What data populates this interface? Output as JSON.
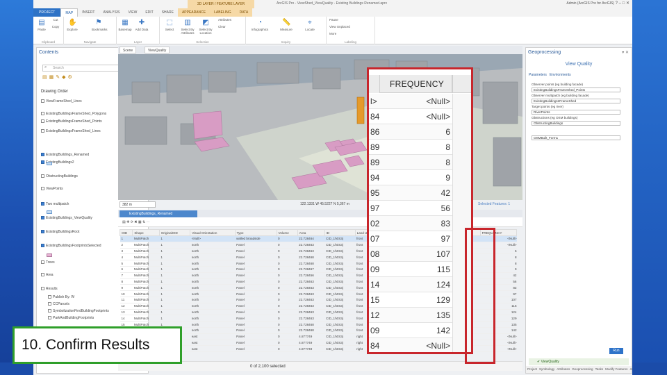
{
  "window": {
    "title": "ArcGIS Pro - ViewShed_ViewQuality - Existing Buildings Renamed.aprx",
    "context_tab": "3D LAYER / FEATURE LAYER",
    "user": "Admin (ArcGIS Pro for ArcGIS)"
  },
  "ribbon": {
    "tabs": [
      "PROJECT",
      "MAP",
      "INSERT",
      "ANALYSIS",
      "VIEW",
      "EDIT",
      "SHARE",
      "APPEARANCE",
      "LABELING",
      "DATA"
    ],
    "active_tab": "MAP",
    "groups": {
      "clipboard": "Clipboard",
      "navigate": "Navigate",
      "layer": "Layer",
      "selection": "Selection",
      "inquiry": "Inquiry",
      "labeling": "Labeling"
    },
    "buttons": {
      "paste": "Paste",
      "cut": "Cut",
      "copy": "Copy",
      "explore": "Explore",
      "bookmarks": "Bookmarks",
      "basemap": "Basemap",
      "add_data": "Add Data",
      "select": "Select",
      "select_by_attributes": "Select By Attributes",
      "select_by_location": "Select By Location",
      "attributes": "Attributes",
      "clear": "Clear",
      "infographics": "Infographics",
      "measure": "Measure",
      "locate": "Locate",
      "pause": "Pause",
      "view_unplaced": "View Unplaced",
      "more": "More"
    }
  },
  "contents": {
    "title": "Contents",
    "search_placeholder": "Search",
    "drawing_order": "Drawing Order",
    "layers": [
      {
        "name": "ViewFrameShed_Lines",
        "checked": false
      },
      {
        "name": "ExistingBuildingsFrameShed_Polygons",
        "checked": false
      },
      {
        "name": "ExistingBuildingsFrameShed_Points",
        "checked": false
      },
      {
        "name": "ExistingBuildingsFrameShed_Lines",
        "checked": false
      },
      {
        "name": "ExistingBuildings_Renamed",
        "checked": true
      },
      {
        "name": "ExistingBuildings2",
        "checked": true
      },
      {
        "name": "ObstructingBuildings",
        "checked": false
      },
      {
        "name": "ViewPoints",
        "checked": false
      },
      {
        "name": "Two multipatch",
        "checked": true
      },
      {
        "name": "ExistingBuildings_ViewQuality",
        "checked": true
      },
      {
        "name": "ExistingBuildingsRoot",
        "checked": true
      },
      {
        "name": "ExistingBuildingsFootprintsSelected",
        "checked": true
      },
      {
        "name": "Trees",
        "checked": false
      },
      {
        "name": "Area",
        "checked": false
      },
      {
        "name": "Results",
        "checked": false
      },
      {
        "name": "Publish By: W",
        "checked": false
      },
      {
        "name": "CCParcels",
        "checked": false
      },
      {
        "name": "SymbolizationFindBuildingFootprints",
        "checked": false
      },
      {
        "name": "ParkAndBuildingFootprints",
        "checked": false
      }
    ]
  },
  "scene": {
    "tabs": [
      "Scene",
      "ViewQuality"
    ],
    "scale": "382 m",
    "coords": "122.1331 W 45.5227 N  5,367 m",
    "status": "Selected Features: 1"
  },
  "attribute_table": {
    "tab_label": "ExistingBuildings_Renamed",
    "columns": [
      "OID",
      "Shape",
      "OriginalOID",
      "Visual Orientation",
      "Type",
      "Volume",
      "Area",
      "ID",
      "Land Use",
      "Orientation",
      "Shape_Length",
      "Shape_Area",
      "FREQUENCY"
    ],
    "rows": [
      [
        "1",
        "MultiPatch",
        "1",
        "<Null>",
        "walled broadside",
        "0",
        "22.728464",
        "CID_1h0S3j",
        "front",
        "9",
        "23.72",
        "84",
        "<Null>"
      ],
      [
        "2",
        "MultiPatch",
        "1",
        "north",
        "Panel",
        "0",
        "22.728463",
        "CID_1h0S3j",
        "front",
        "9",
        "23.72",
        "86",
        "<Null>"
      ],
      [
        "3",
        "MultiPatch",
        "1",
        "north",
        "Panel",
        "0",
        "22.728463",
        "CID_1h0S3j",
        "front",
        "9",
        "23.72",
        "89",
        "6"
      ],
      [
        "4",
        "MultiPatch",
        "1",
        "north",
        "Panel",
        "0",
        "22.728468",
        "CID_1h0S3j",
        "front",
        "9",
        "23.72",
        "89",
        "8"
      ],
      [
        "5",
        "MultiPatch",
        "1",
        "north",
        "Panel",
        "0",
        "22.728468",
        "CID_1h0S3j",
        "front",
        "9",
        "23.72",
        "94",
        "8"
      ],
      [
        "6",
        "MultiPatch",
        "1",
        "north",
        "Panel",
        "0",
        "22.728467",
        "CID_1h0S3j",
        "front",
        "9",
        "23.72",
        "95",
        "9"
      ],
      [
        "7",
        "MultiPatch",
        "1",
        "north",
        "Panel",
        "0",
        "22.728456",
        "CID_1h0S3j",
        "front",
        "9",
        "23.72",
        "97",
        "42"
      ],
      [
        "8",
        "MultiPatch",
        "1",
        "north",
        "Panel",
        "0",
        "22.728463",
        "CID_1h0S3j",
        "front",
        "9",
        "23.72",
        "02",
        "56"
      ],
      [
        "9",
        "MultiPatch",
        "1",
        "north",
        "Panel",
        "0",
        "22.728463",
        "CID_1h0S3j",
        "front",
        "9",
        "23.72",
        "07",
        "83"
      ],
      [
        "10",
        "MultiPatch",
        "1",
        "north",
        "Panel",
        "0",
        "22.728463",
        "CID_1h0S3j",
        "front",
        "9",
        "23.72",
        "08",
        "97"
      ],
      [
        "11",
        "MultiPatch",
        "1",
        "north",
        "Panel",
        "0",
        "22.728463",
        "CID_1h0S3j",
        "front",
        "9",
        "23.72",
        "09",
        "107"
      ],
      [
        "12",
        "MultiPatch",
        "1",
        "north",
        "Panel",
        "0",
        "22.728463",
        "CID_1h0S3j",
        "front",
        "9",
        "23.72",
        "14",
        "115"
      ],
      [
        "13",
        "MultiPatch",
        "1",
        "north",
        "Panel",
        "0",
        "22.728463",
        "CID_1h0S3j",
        "front",
        "9",
        "23.72",
        "15",
        "124"
      ],
      [
        "14",
        "MultiPatch",
        "1",
        "north",
        "Panel",
        "0",
        "22.728463",
        "CID_1h0S3j",
        "front",
        "9",
        "23.72",
        "12",
        "129"
      ],
      [
        "15",
        "MultiPatch",
        "1",
        "north",
        "Panel",
        "0",
        "22.728468",
        "CID_1h0S3j",
        "front",
        "9",
        "23.72",
        "09",
        "135"
      ],
      [
        "16",
        "MultiPatch",
        "1",
        "north",
        "Panel",
        "0",
        "22.728468",
        "CID_1h0S3j",
        "front",
        "9",
        "23.72",
        "84",
        "142"
      ],
      [
        "17",
        "MultiPatch",
        "1",
        "east",
        "Panel",
        "0",
        "4.877749",
        "CID_1h0S3j",
        "right",
        "9",
        "23.72",
        "84",
        "<Null>"
      ],
      [
        "18",
        "MultiPatch",
        "1",
        "east",
        "Panel",
        "0",
        "4.877749",
        "CID_1h0S3j",
        "right",
        "9",
        "23.72",
        "84",
        "<Null>"
      ],
      [
        "19",
        "MultiPatch",
        "1",
        "east",
        "Panel",
        "0",
        "4.877749",
        "CID_1h0S3j",
        "right",
        "9",
        "23.72",
        "84",
        "<Null>"
      ]
    ],
    "status": "0 of 2,100 selected"
  },
  "frequency_callout": {
    "header": "FREQUENCY",
    "rows": [
      {
        "key": "l>",
        "value": "<Null>"
      },
      {
        "key": "84",
        "value": "<Null>"
      },
      {
        "key": "86",
        "value": "6"
      },
      {
        "key": "89",
        "value": "8"
      },
      {
        "key": "89",
        "value": "8"
      },
      {
        "key": "94",
        "value": "9"
      },
      {
        "key": "95",
        "value": "42"
      },
      {
        "key": "97",
        "value": "56"
      },
      {
        "key": "02",
        "value": "83"
      },
      {
        "key": "07",
        "value": "97"
      },
      {
        "key": "08",
        "value": "107"
      },
      {
        "key": "09",
        "value": "115"
      },
      {
        "key": "14",
        "value": "124"
      },
      {
        "key": "15",
        "value": "129"
      },
      {
        "key": "12",
        "value": "135"
      },
      {
        "key": "09",
        "value": "142"
      },
      {
        "key": "84",
        "value": "<Null>"
      }
    ]
  },
  "geoprocessing": {
    "title": "Geoprocessing",
    "tool": "View Quality",
    "tabs": [
      "Parameters",
      "Environments"
    ],
    "params": [
      {
        "label": "Observer points (eg building facade)",
        "value": "ExistingBuildingsFrameShed_Points"
      },
      {
        "label": "Observer multipatch (eg building facade)",
        "value": "ExistingBuildings2FrameShed"
      },
      {
        "label": "Target points (eg river)",
        "value": "RiverPoints"
      },
      {
        "label": "Obstructions (eg OSM buildings)",
        "value": "ObstructingBuildings"
      },
      {
        "label": "",
        "value": "OSMBuilt_Form1"
      }
    ],
    "run": "Run",
    "done": "ViewQuality",
    "bottom_tabs": [
      "Project",
      "Symbology",
      "Attributes",
      "Geoprocessing",
      "Tasks",
      "Modify Features",
      "Join Sym",
      "Catalog"
    ]
  },
  "step_label": "10. Confirm Results",
  "colors": {
    "accent": "#2d72c6",
    "highlight_red": "#c8262c",
    "label_border_green": "#2f9f2a",
    "building_pink": "#d89cc4"
  }
}
